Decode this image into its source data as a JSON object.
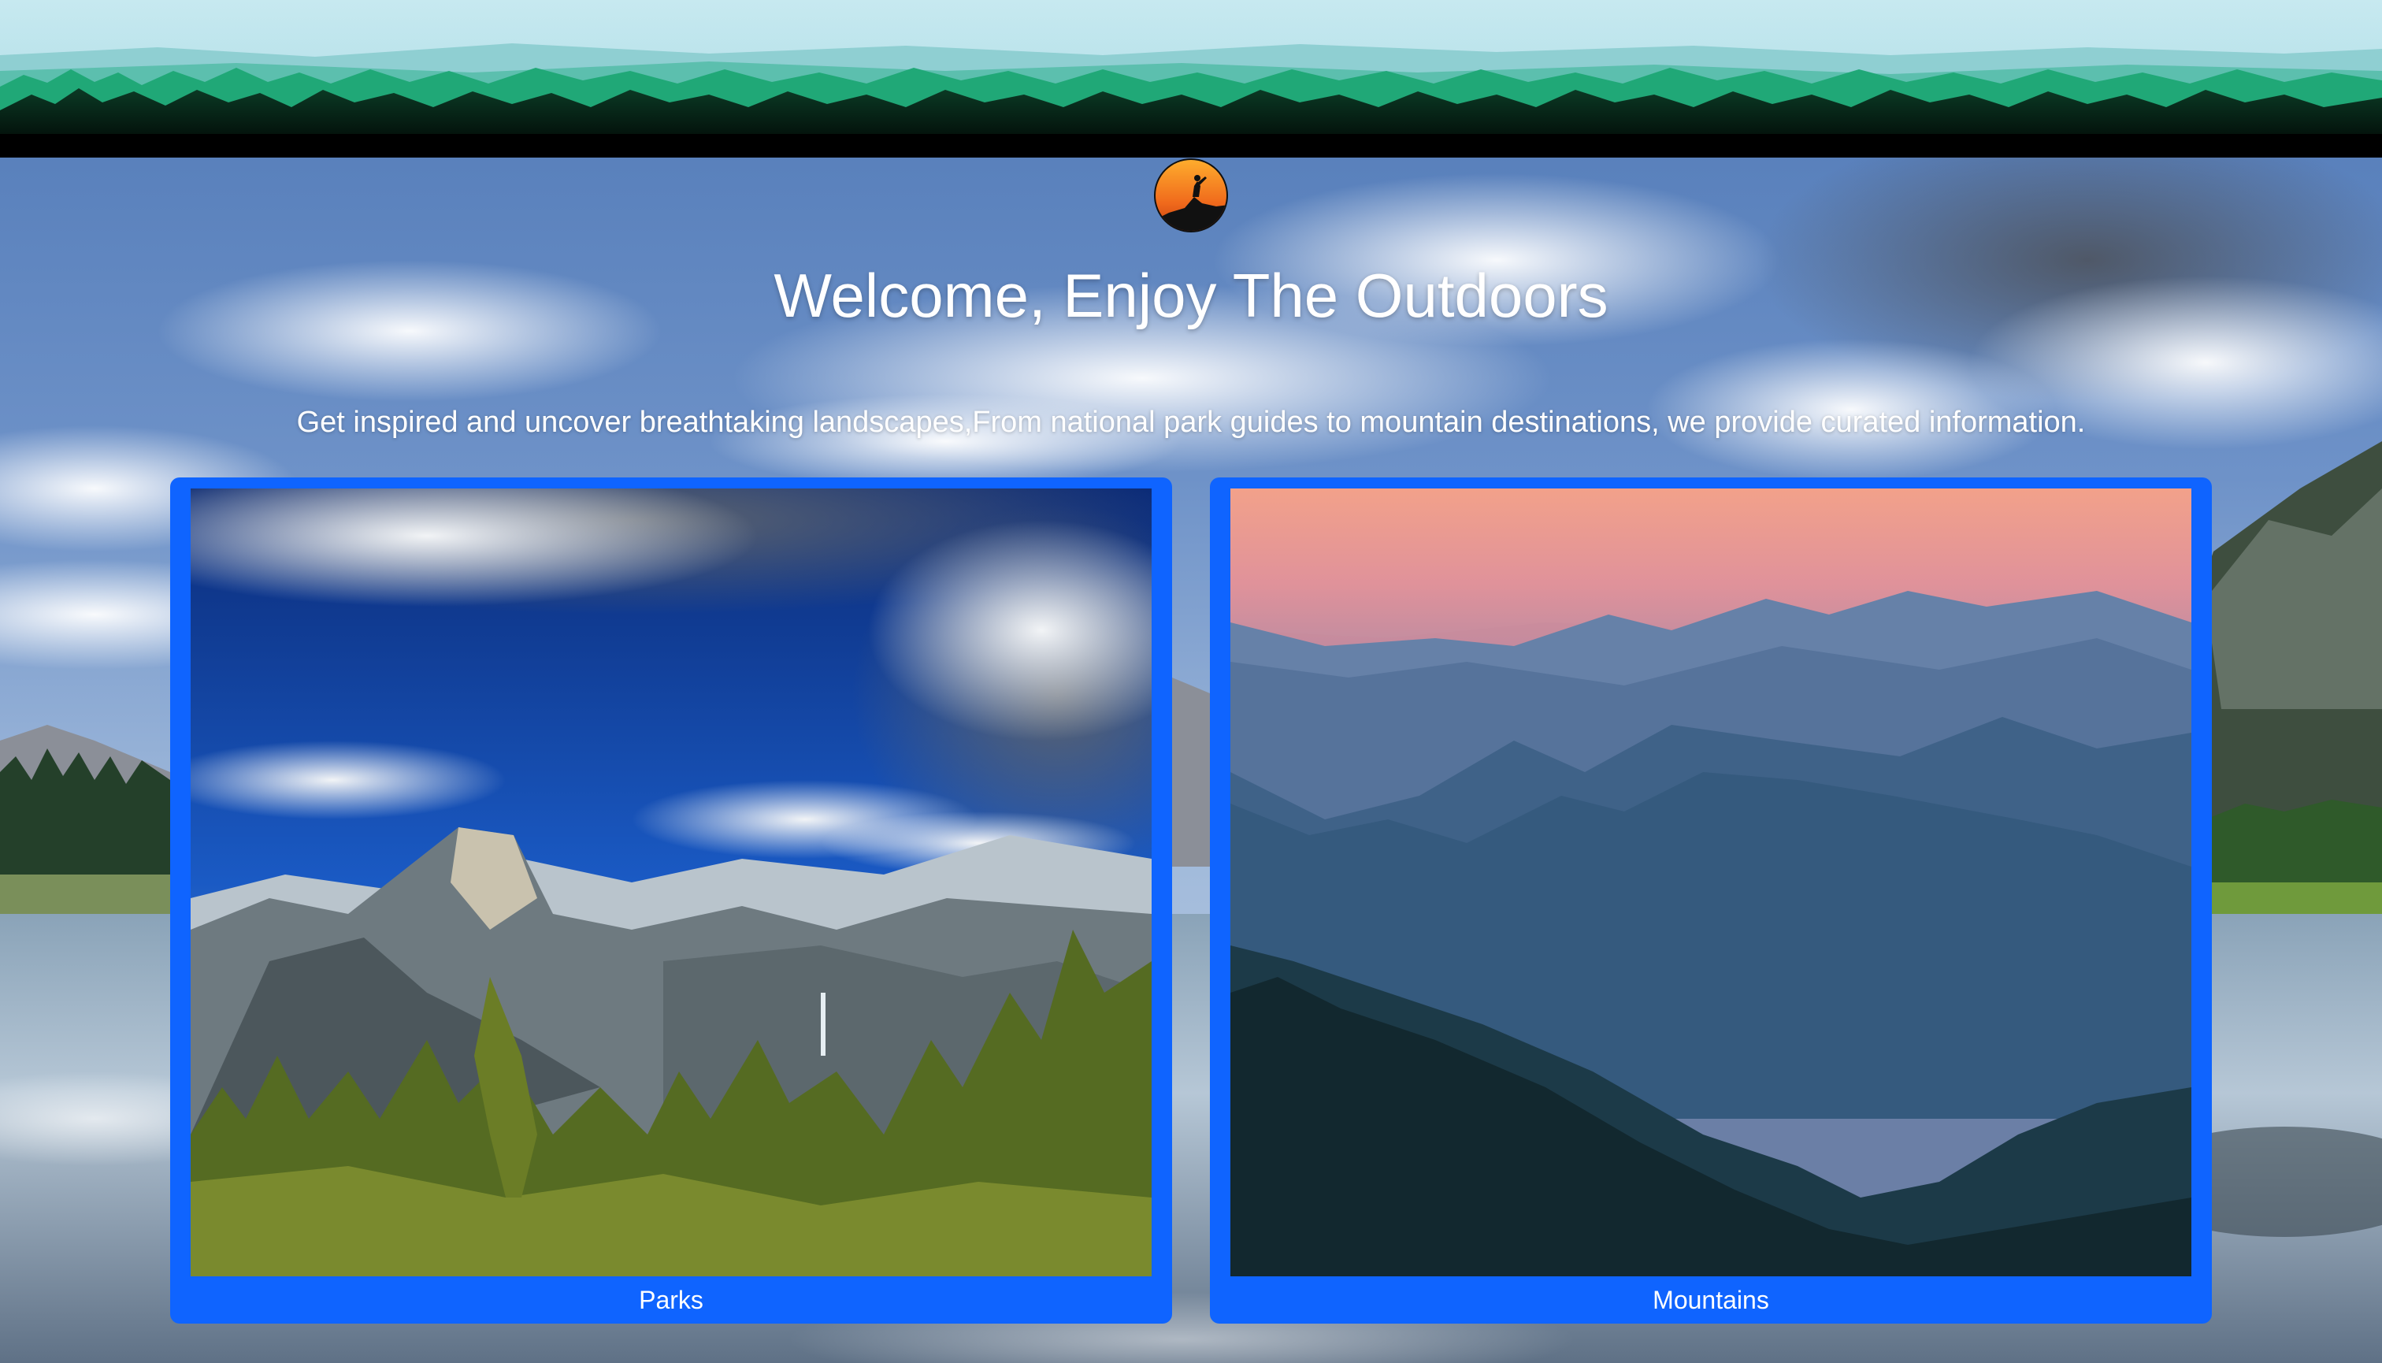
{
  "page": {
    "title": "Welcome, Enjoy The Outdoors",
    "tagline": "Get inspired and uncover breathtaking landscapes,From national park guides to mountain destinations, we provide curated information."
  },
  "header": {
    "banner_icon": "forest-silhouette-banner",
    "logo_icon": "hiker-sunset-logo"
  },
  "cards": [
    {
      "label": "Parks",
      "image": "yosemite-valley-photo"
    },
    {
      "label": "Mountains",
      "image": "misty-mountain-ridges-photo"
    }
  ],
  "colors": {
    "card_background": "#0f64ff",
    "text": "#ffffff",
    "banner_sky": "#c3e6ee",
    "banner_trees": "#1fa37a"
  }
}
